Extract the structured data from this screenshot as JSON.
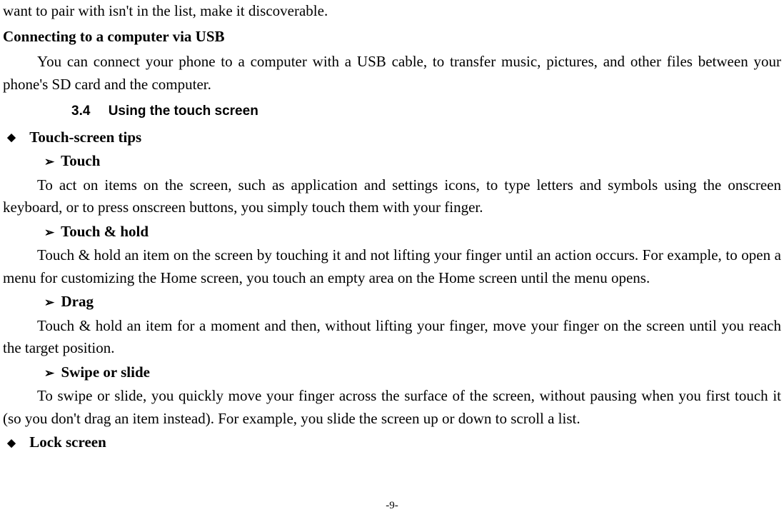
{
  "partial_top": "want to pair with isn't in the list, make it discoverable.",
  "usb_heading": "Connecting to a computer via USB",
  "usb_body": "You can connect your phone to a computer with a USB cable, to transfer music, pictures, and other files between your phone's SD card and the computer.",
  "section": {
    "number": "3.4",
    "title": "Using the touch screen"
  },
  "tips_heading": "Touch-screen tips",
  "touch": {
    "title": "Touch",
    "body": "To act on items on the screen, such as application and settings icons, to type letters and symbols using the onscreen keyboard, or to press onscreen buttons, you simply touch them with your finger."
  },
  "touch_hold": {
    "title": "Touch & hold",
    "body": "Touch & hold an item on the screen by touching it and not lifting your finger until an action occurs. For example, to open a menu for customizing the Home screen, you touch an empty area on the Home screen until the menu opens."
  },
  "drag": {
    "title": "Drag",
    "body": "Touch & hold an item for a moment and then, without lifting your finger, move your finger on the screen until you reach the target position."
  },
  "swipe": {
    "title": "Swipe or slide",
    "body": "To swipe or slide, you quickly move your finger across the surface of the screen, without pausing when you first touch it (so you don't drag an item instead). For example, you slide the screen up or down to scroll a list."
  },
  "lock_heading": "Lock screen",
  "page_number": "-9-"
}
